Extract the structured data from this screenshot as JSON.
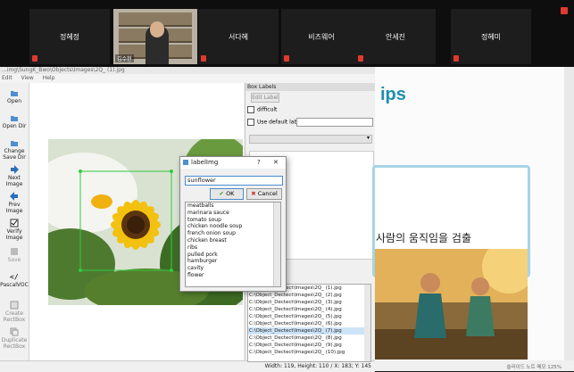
{
  "participants": [
    {
      "name": "정혜정"
    },
    {
      "name": "김수현"
    },
    {
      "name": "서다혜"
    },
    {
      "name": "비즈웨어"
    },
    {
      "name": "안세진"
    },
    {
      "name": "정혜미"
    }
  ],
  "app": {
    "title": "...img\\SungK_Bwo\\Objects\\Images\\2Q_ (1).jpg",
    "menu": [
      "Edit",
      "View",
      "Help"
    ],
    "toolbar": [
      {
        "label": "Open",
        "icon": "folder-icon"
      },
      {
        "label": "Open Dir",
        "icon": "folder-icon"
      },
      {
        "label": "Change Save Dir",
        "icon": "folder-icon"
      },
      {
        "label": "Next Image",
        "icon": "arrow-right-icon"
      },
      {
        "label": "Prev Image",
        "icon": "arrow-left-icon"
      },
      {
        "label": "Verify Image",
        "icon": "check-icon"
      },
      {
        "label": "Save",
        "icon": "save-icon"
      },
      {
        "label": "PascalVOC",
        "icon": "code-icon"
      },
      {
        "label": "Create RectBox",
        "icon": "box-icon"
      },
      {
        "label": "Duplicate RectBox",
        "icon": "copy-icon"
      }
    ],
    "box_labels": {
      "header": "Box Labels",
      "edit_label": "Edit Label",
      "difficult": "difficult",
      "use_default": "Use default label"
    },
    "files": [
      "C:\\Object_Dectect\\Images\\2Q_ (1).jpg",
      "C:\\Object_Dectect\\Images\\2Q_ (2).jpg",
      "C:\\Object_Dectect\\Images\\2Q_ (3).jpg",
      "C:\\Object_Dectect\\Images\\2Q_ (4).jpg",
      "C:\\Object_Dectect\\Images\\2Q_ (5).jpg",
      "C:\\Object_Dectect\\Images\\2Q_ (6).jpg",
      "C:\\Object_Dectect\\Images\\2Q_ (7).jpg",
      "C:\\Object_Dectect\\Images\\2Q_ (8).jpg",
      "C:\\Object_Dectect\\Images\\2Q_ (9).jpg",
      "C:\\Object_Dectect\\Images\\2Q_ (10).jpg"
    ],
    "selected_file": 6,
    "status": "Width: 119, Height: 110 / X: 183; Y: 145"
  },
  "dialog": {
    "title": "labelImg",
    "help": "?",
    "close": "✕",
    "value": "sunflower",
    "ok": "OK",
    "cancel": "Cancel",
    "options": [
      "meatballs",
      "marinara sauce",
      "tomato soup",
      "chicken noodle soup",
      "french onion soup",
      "chicken breast",
      "ribs",
      "pulled pork",
      "hamburger",
      "cavity",
      "flower"
    ]
  },
  "slide": {
    "title_fragment": "ips",
    "text": "사람의 움직임을 검출",
    "status": "슬라이드 노트   메모     125%"
  },
  "colors": {
    "accent": "#1d8fae",
    "bbox": "#2ecc40",
    "dialog_focus": "#4a8bd0"
  }
}
